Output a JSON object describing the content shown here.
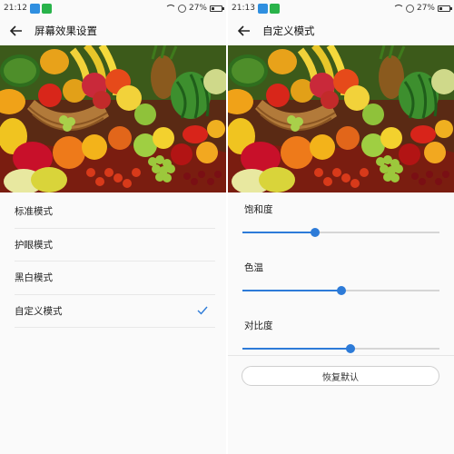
{
  "colors": {
    "accent": "#2d7bd8",
    "background": "#fafafa"
  },
  "left": {
    "status": {
      "time": "21:12",
      "battery": "27%"
    },
    "title": "屏幕效果设置",
    "back_icon": "arrow-left-icon",
    "image_description": "fruit basket photo",
    "modes": [
      {
        "label": "标准模式",
        "selected": false
      },
      {
        "label": "护眼模式",
        "selected": false
      },
      {
        "label": "黑白模式",
        "selected": false
      },
      {
        "label": "自定义模式",
        "selected": true
      }
    ]
  },
  "right": {
    "status": {
      "time": "21:13",
      "battery": "27%"
    },
    "title": "自定义模式",
    "back_icon": "arrow-left-icon",
    "sliders": [
      {
        "label": "饱和度",
        "value": 0.37
      },
      {
        "label": "色温",
        "value": 0.5
      },
      {
        "label": "对比度",
        "value": 0.55
      }
    ],
    "restore_label": "恢复默认"
  }
}
